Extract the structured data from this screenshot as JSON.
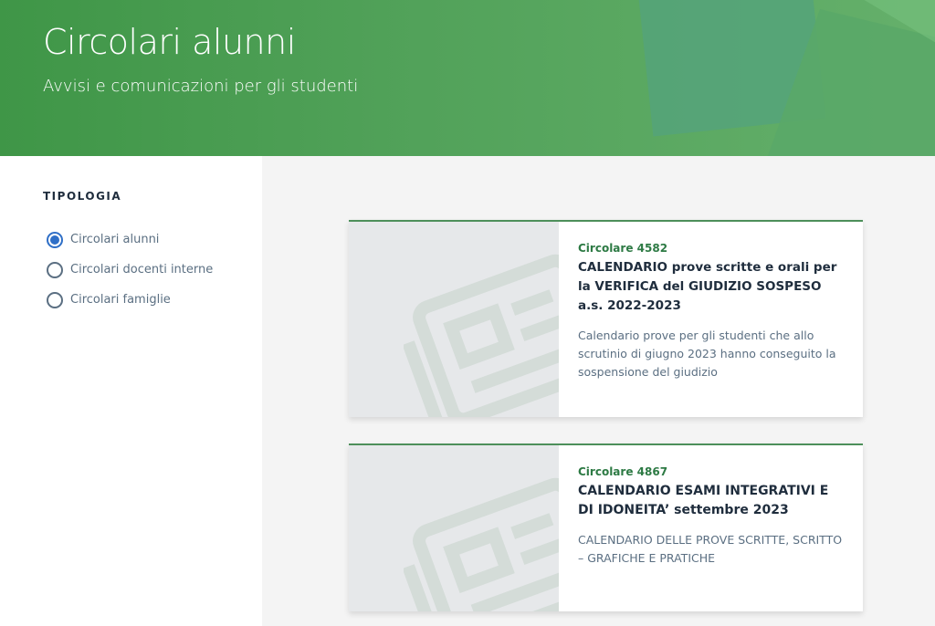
{
  "hero": {
    "title": "Circolari alunni",
    "subtitle": "Avvisi e comunicazioni per gli studenti"
  },
  "filter": {
    "heading": "TIPOLOGIA",
    "options": [
      {
        "label": "Circolari alunni",
        "checked": true
      },
      {
        "label": "Circolari docenti interne",
        "checked": false
      },
      {
        "label": "Circolari famiglie",
        "checked": false
      }
    ]
  },
  "cards": [
    {
      "kicker": "Circolare 4582",
      "title": "CALENDARIO prove scritte e orali per la VERIFICA del GIUDIZIO SOSPESO a.s. 2022-2023",
      "description": "Calendario prove per gli studenti che allo scrutinio di giugno 2023 hanno conseguito la sospensione del giudizio",
      "image_icon": "newspaper-icon"
    },
    {
      "kicker": "Circolare 4867",
      "title": "CALENDARIO ESAMI INTEGRATIVI E DI IDONEITA’ settembre 2023",
      "description": "CALENDARIO DELLE PROVE SCRITTE, SCRITTO – GRAFICHE E PRATICHE",
      "image_icon": "newspaper-icon"
    }
  ],
  "colors": {
    "hero_green": "#4f9f57",
    "accent_green": "#2d7a44",
    "radio_blue": "#2f6fc7"
  }
}
